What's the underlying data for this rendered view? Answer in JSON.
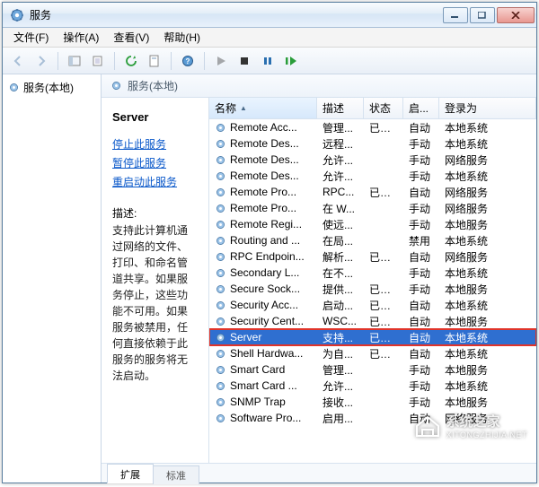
{
  "window": {
    "title": "服务"
  },
  "menus": {
    "file": "文件(F)",
    "action": "操作(A)",
    "view": "查看(V)",
    "help": "帮助(H)"
  },
  "tree": {
    "root": "服务(本地)"
  },
  "breadcrumb": {
    "label": "服务(本地)"
  },
  "detail": {
    "title": "Server",
    "stop": "停止此服务",
    "pause": "暂停此服务",
    "restart": "重启动此服务",
    "desc_label": "描述:",
    "desc": "支持此计算机通过网络的文件、打印、和命名管道共享。如果服务停止，这些功能不可用。如果服务被禁用，任何直接依赖于此服务的服务将无法启动。"
  },
  "columns": {
    "name": "名称",
    "desc": "描述",
    "status": "状态",
    "start": "启...",
    "logon": "登录为"
  },
  "tabs": {
    "extended": "扩展",
    "standard": "标准"
  },
  "watermark": {
    "name": "系统之家",
    "url": "XITONGZHIJIA.NET"
  },
  "rows": [
    {
      "name": "Remote Acc...",
      "desc": "管理...",
      "status": "已启动",
      "start": "自动",
      "logon": "本地系统"
    },
    {
      "name": "Remote Des...",
      "desc": "远程...",
      "status": "",
      "start": "手动",
      "logon": "本地系统"
    },
    {
      "name": "Remote Des...",
      "desc": "允许...",
      "status": "",
      "start": "手动",
      "logon": "网络服务"
    },
    {
      "name": "Remote Des...",
      "desc": "允许...",
      "status": "",
      "start": "手动",
      "logon": "本地系统"
    },
    {
      "name": "Remote Pro...",
      "desc": "RPC...",
      "status": "已启动",
      "start": "自动",
      "logon": "网络服务"
    },
    {
      "name": "Remote Pro...",
      "desc": "在 W...",
      "status": "",
      "start": "手动",
      "logon": "网络服务"
    },
    {
      "name": "Remote Regi...",
      "desc": "使远...",
      "status": "",
      "start": "手动",
      "logon": "本地服务"
    },
    {
      "name": "Routing and ...",
      "desc": "在局...",
      "status": "",
      "start": "禁用",
      "logon": "本地系统"
    },
    {
      "name": "RPC Endpoin...",
      "desc": "解析...",
      "status": "已启动",
      "start": "自动",
      "logon": "网络服务"
    },
    {
      "name": "Secondary L...",
      "desc": "在不...",
      "status": "",
      "start": "手动",
      "logon": "本地系统"
    },
    {
      "name": "Secure Sock...",
      "desc": "提供...",
      "status": "已启动",
      "start": "手动",
      "logon": "本地服务"
    },
    {
      "name": "Security Acc...",
      "desc": "启动...",
      "status": "已启动",
      "start": "自动",
      "logon": "本地系统"
    },
    {
      "name": "Security Cent...",
      "desc": "WSC...",
      "status": "已启动",
      "start": "自动",
      "logon": "本地服务"
    },
    {
      "name": "Server",
      "desc": "支持...",
      "status": "已启动",
      "start": "自动",
      "logon": "本地系统",
      "selected": true,
      "highlighted": true
    },
    {
      "name": "Shell Hardwa...",
      "desc": "为自...",
      "status": "已启动",
      "start": "自动",
      "logon": "本地系统"
    },
    {
      "name": "Smart Card",
      "desc": "管理...",
      "status": "",
      "start": "手动",
      "logon": "本地服务"
    },
    {
      "name": "Smart Card ...",
      "desc": "允许...",
      "status": "",
      "start": "手动",
      "logon": "本地系统"
    },
    {
      "name": "SNMP Trap",
      "desc": "接收...",
      "status": "",
      "start": "手动",
      "logon": "本地服务"
    },
    {
      "name": "Software Pro...",
      "desc": "启用...",
      "status": "",
      "start": "自动",
      "logon": "网络服务"
    }
  ]
}
